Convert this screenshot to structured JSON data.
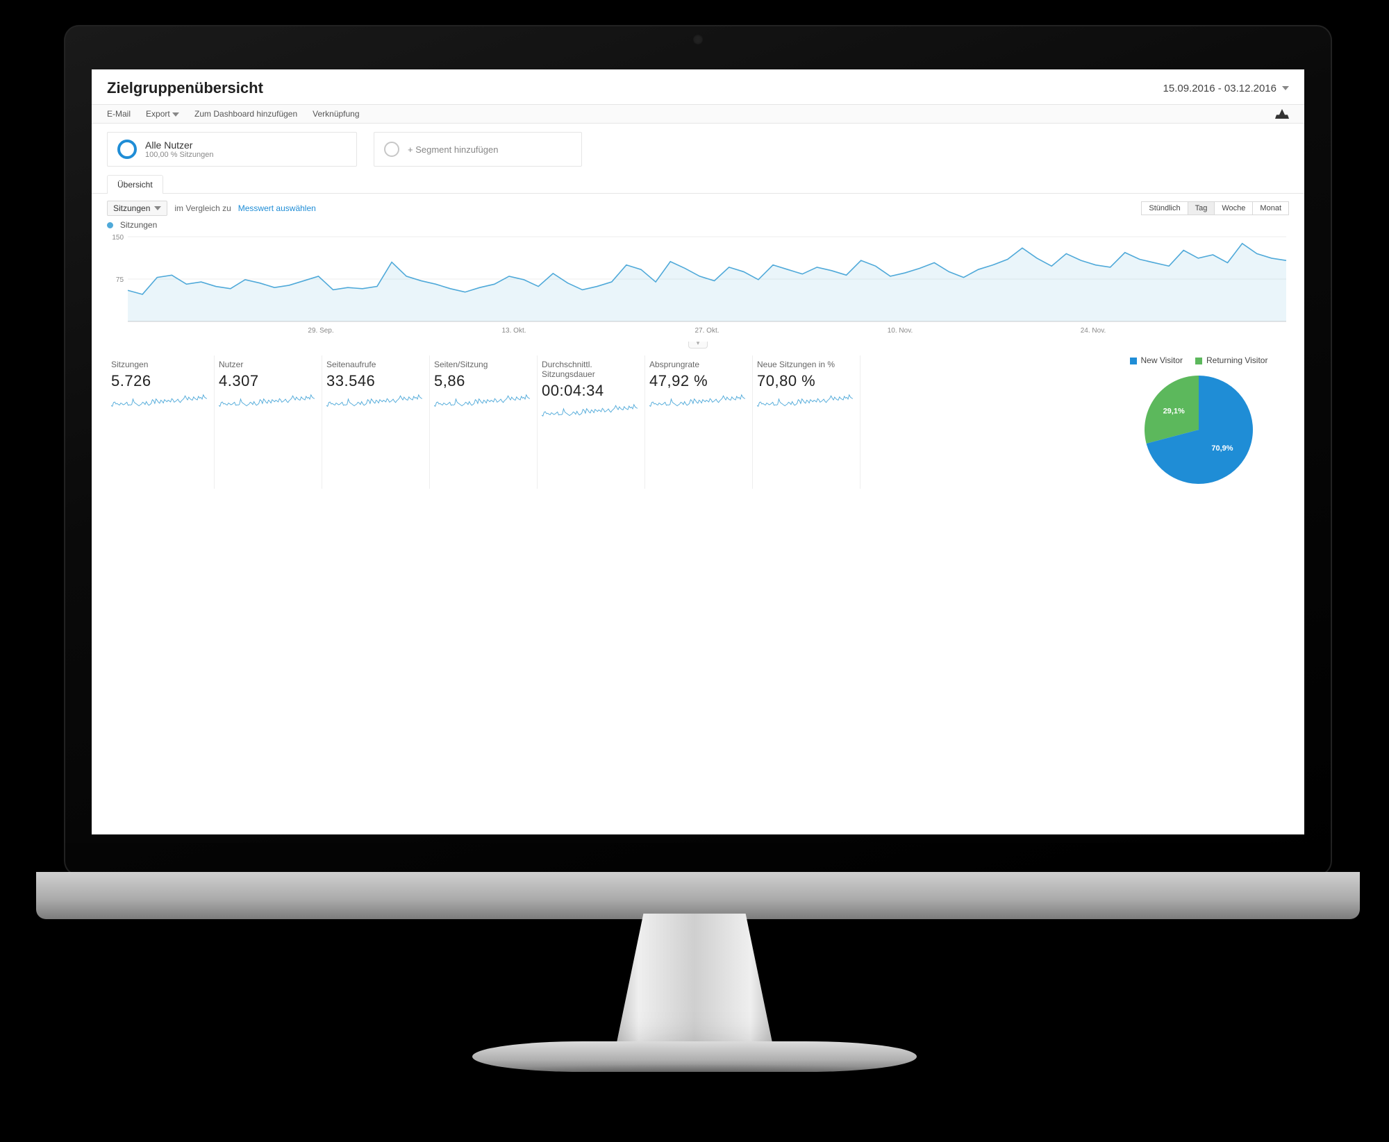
{
  "header": {
    "title": "Zielgruppenübersicht",
    "date_range": "15.09.2016 - 03.12.2016"
  },
  "toolbar": {
    "email": "E-Mail",
    "export": "Export",
    "add_dashboard": "Zum Dashboard hinzufügen",
    "shortcut": "Verknüpfung"
  },
  "segments": {
    "primary": {
      "title": "Alle Nutzer",
      "subtitle": "100,00 % Sitzungen"
    },
    "add": {
      "label": "+ Segment hinzufügen"
    }
  },
  "tab_overview": "Übersicht",
  "metric_bar": {
    "dropdown": "Sitzungen",
    "vs_label": "im Vergleich zu",
    "select_metric": "Messwert auswählen"
  },
  "granularity": {
    "hourly": "Stündlich",
    "day": "Tag",
    "week": "Woche",
    "month": "Monat",
    "active": "day"
  },
  "chart_legend": "Sitzungen",
  "chart_data": {
    "type": "line",
    "title": "Sitzungen",
    "xlabel": "",
    "ylabel": "",
    "ylim": [
      0,
      150
    ],
    "y_ticks": [
      75,
      150
    ],
    "x_tick_labels": [
      "29. Sep.",
      "13. Okt.",
      "27. Okt.",
      "10. Nov.",
      "24. Nov."
    ],
    "series": [
      {
        "name": "Sitzungen",
        "values": [
          55,
          48,
          78,
          82,
          66,
          70,
          62,
          58,
          74,
          68,
          60,
          64,
          72,
          80,
          56,
          60,
          58,
          62,
          105,
          80,
          72,
          66,
          58,
          52,
          60,
          66,
          80,
          74,
          62,
          85,
          68,
          56,
          62,
          70,
          100,
          92,
          70,
          106,
          94,
          80,
          72,
          96,
          88,
          74,
          100,
          92,
          84,
          96,
          90,
          82,
          108,
          98,
          80,
          86,
          94,
          104,
          88,
          78,
          92,
          100,
          110,
          130,
          112,
          98,
          120,
          108,
          100,
          96,
          122,
          110,
          104,
          98,
          126,
          112,
          118,
          104,
          138,
          120,
          112,
          108
        ]
      }
    ]
  },
  "kpis": [
    {
      "label": "Sitzungen",
      "value": "5.726"
    },
    {
      "label": "Nutzer",
      "value": "4.307"
    },
    {
      "label": "Seitenaufrufe",
      "value": "33.546"
    },
    {
      "label": "Seiten/Sitzung",
      "value": "5,86"
    },
    {
      "label": "Durchschnittl. Sitzungsdauer",
      "value": "00:04:34"
    },
    {
      "label": "Absprungrate",
      "value": "47,92 %"
    },
    {
      "label": "Neue Sitzungen in %",
      "value": "70,80 %"
    }
  ],
  "pie": {
    "legend": {
      "new": "New Visitor",
      "returning": "Returning Visitor"
    },
    "data": {
      "new_pct": 70.9,
      "returning_pct": 29.1,
      "new_label": "70,9%",
      "returning_label": "29,1%"
    }
  }
}
